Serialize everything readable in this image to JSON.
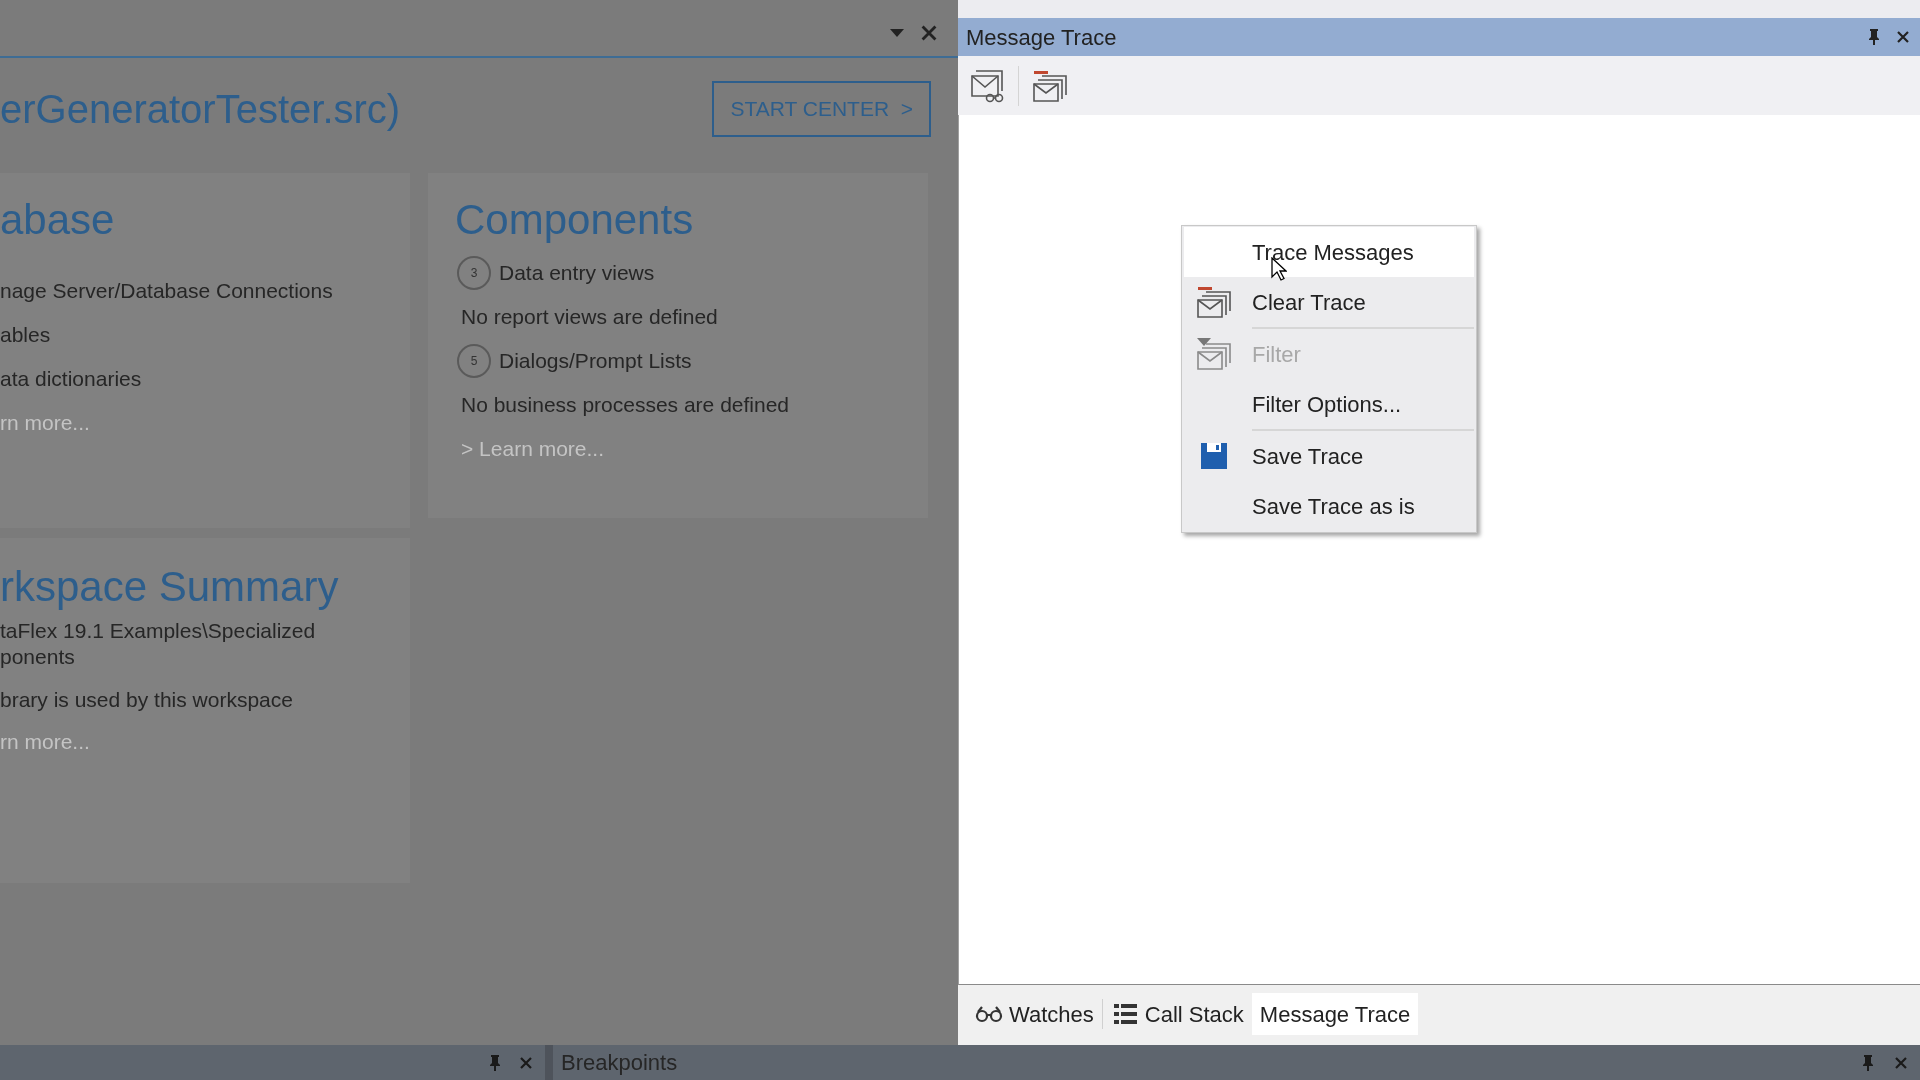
{
  "start_page": {
    "title": "erGeneratorTester.src)",
    "start_center_button": "START CENTER  >",
    "database": {
      "heading": "abase",
      "items": [
        "nage Server/Database Connections",
        "ables",
        "ata dictionaries"
      ],
      "learn_more": "rn more..."
    },
    "components": {
      "heading": "Components",
      "items": [
        {
          "kind": "count",
          "count": "3",
          "label": "Data entry views"
        },
        {
          "kind": "note",
          "label": "No report views are defined"
        },
        {
          "kind": "count",
          "count": "5",
          "label": "Dialogs/Prompt Lists"
        },
        {
          "kind": "note",
          "label": "No business processes are defined"
        }
      ],
      "learn_more": "> Learn more..."
    },
    "workspace_summary": {
      "heading": "rkspace Summary",
      "lines": [
        "taFlex 19.1 Examples\\Specialized",
        "ponents",
        "brary is used by this workspace"
      ],
      "learn_more": "rn more..."
    }
  },
  "breakpoints_panel": {
    "title": "Breakpoints"
  },
  "message_trace": {
    "title": "Message Trace",
    "menu": [
      {
        "label": "Trace Messages",
        "kind": "plain",
        "highlighted": true,
        "disabled": false,
        "separator_after": false
      },
      {
        "label": "Clear Trace",
        "kind": "clear",
        "highlighted": false,
        "disabled": false,
        "separator_after": true
      },
      {
        "label": "Filter",
        "kind": "filter",
        "highlighted": false,
        "disabled": true,
        "separator_after": false
      },
      {
        "label": "Filter Options...",
        "kind": "plain",
        "highlighted": false,
        "disabled": false,
        "separator_after": true
      },
      {
        "label": "Save Trace",
        "kind": "save",
        "highlighted": false,
        "disabled": false,
        "separator_after": false
      },
      {
        "label": "Save Trace as is",
        "kind": "plain",
        "highlighted": false,
        "disabled": false,
        "separator_after": false
      }
    ],
    "tabs": [
      {
        "label": "Watches",
        "kind": "watches",
        "selected": false
      },
      {
        "label": "Call Stack",
        "kind": "call_stack",
        "selected": false
      },
      {
        "label": "Message Trace",
        "kind": "plain",
        "selected": true
      }
    ]
  }
}
